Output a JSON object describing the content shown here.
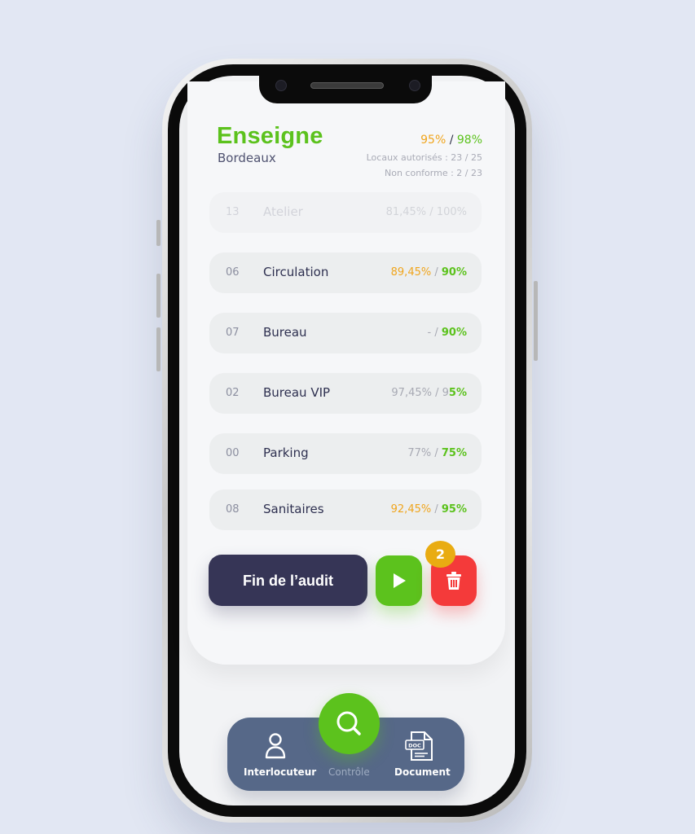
{
  "header": {
    "title": "Enseigne",
    "subtitle": "Bordeaux",
    "score_orange": "95%",
    "score_sep": " / ",
    "score_green": "98%",
    "stat1": "Locaux autorisés : 23 / 25",
    "stat2": "Non conforme : 2 / 23"
  },
  "rows": [
    {
      "num": "13",
      "name": "Atelier",
      "val_a": "81,45%",
      "sep": " / ",
      "val_b": "100%"
    },
    {
      "num": "06",
      "name": "Circulation",
      "val_a": "89,45%",
      "sep": " / ",
      "val_b": "90%"
    },
    {
      "num": "07",
      "name": "Bureau",
      "val_a": "-",
      "sep": " / ",
      "val_b": "90%"
    },
    {
      "num": "02",
      "name": "Bureau VIP",
      "val_a": "97,45%",
      "sep": " / ",
      "val_b_plain": "9",
      "val_b": "5%"
    },
    {
      "num": "00",
      "name": "Parking",
      "val_a": "77%",
      "sep": " / ",
      "val_b": "75%"
    },
    {
      "num": "08",
      "name": "Sanitaires",
      "val_a": "92,45%",
      "sep": " / ",
      "val_b": "95%"
    }
  ],
  "actions": {
    "end_label": "Fin de l’audit",
    "badge_count": "2",
    "play_icon": "play-icon",
    "delete_icon": "trash-icon"
  },
  "nav": {
    "items": [
      {
        "label": "Interlocuteur",
        "icon": "person-icon"
      },
      {
        "label": "Contrôle",
        "icon": "search-icon"
      },
      {
        "label": "Document",
        "icon": "doc-file-icon",
        "icon_text": "DOC"
      }
    ]
  },
  "colors": {
    "green": "#5cc21d",
    "orange": "#f0a51d",
    "navy": "#363556",
    "red": "#f43a3a",
    "nav_bg": "#566888"
  }
}
